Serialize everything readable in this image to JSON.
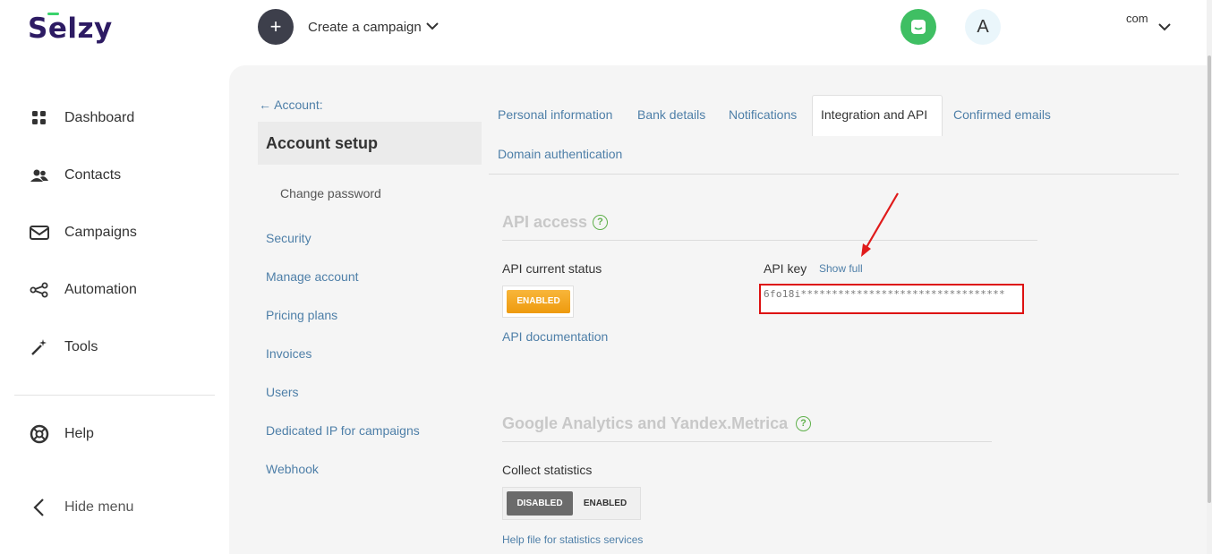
{
  "brand": {
    "logo": "Selzy",
    "accent": "#3ad36c",
    "logo_color": "#2d1b63"
  },
  "topbar": {
    "create_icon": "+",
    "create_label": "Create a campaign",
    "avatar_letter": "A",
    "lang": "com"
  },
  "sidebar": {
    "items": [
      {
        "label": "Dashboard",
        "icon": "grid-icon"
      },
      {
        "label": "Contacts",
        "icon": "people-icon"
      },
      {
        "label": "Campaigns",
        "icon": "envelope-icon"
      },
      {
        "label": "Automation",
        "icon": "automation-icon"
      },
      {
        "label": "Tools",
        "icon": "magic-wand-icon"
      }
    ],
    "help": "Help",
    "hide_menu": "Hide menu"
  },
  "account": {
    "back": "← Account:",
    "title": "Account setup",
    "links": [
      "Change password",
      "Security",
      "Manage account",
      "Pricing plans",
      "Invoices",
      "Users",
      "Dedicated IP for campaigns",
      "Webhook"
    ]
  },
  "tabs": {
    "items": [
      "Personal information",
      "Bank details",
      "Notifications",
      "Integration and API",
      "Confirmed emails",
      "Domain authentication"
    ],
    "active": "Integration and API"
  },
  "api": {
    "title": "API access",
    "help_mark": "?",
    "status_label": "API current status",
    "status_value": "ENABLED",
    "doc_link": "API documentation",
    "key_label": "API key",
    "show_full": "Show full",
    "key_value": "6fo18i*********************************"
  },
  "analytics": {
    "title": "Google Analytics and Yandex.Metrica",
    "help_mark": "?",
    "collect_label": "Collect statistics",
    "disabled": "DISABLED",
    "enabled": "ENABLED",
    "help_link": "Help file for statistics services"
  }
}
